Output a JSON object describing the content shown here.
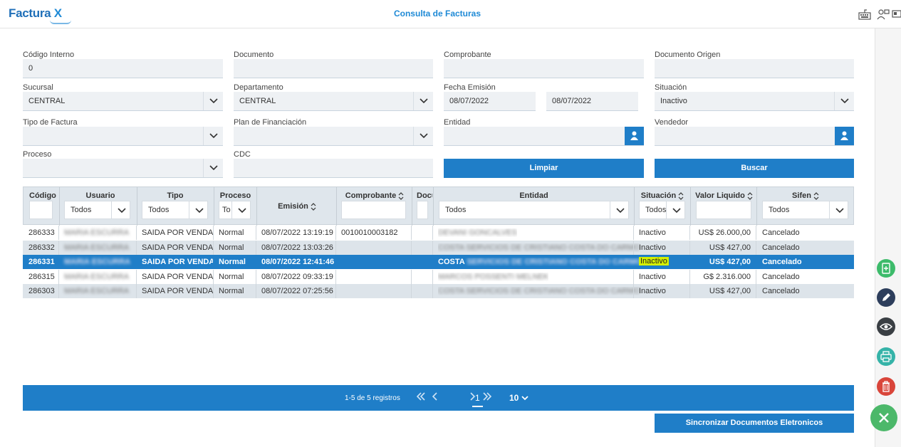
{
  "app": {
    "logo_main": "Factura",
    "logo_x": "X",
    "title": "Consulta de Facturas"
  },
  "form": {
    "codigo_interno": {
      "label": "Código Interno",
      "value": "0"
    },
    "documento": {
      "label": "Documento",
      "value": ""
    },
    "comprobante": {
      "label": "Comprobante",
      "value": ""
    },
    "documento_origen": {
      "label": "Documento Origen",
      "value": ""
    },
    "sucursal": {
      "label": "Sucursal",
      "value": "CENTRAL"
    },
    "departamento": {
      "label": "Departamento",
      "value": "CENTRAL"
    },
    "fecha_emision": {
      "label": "Fecha Emisión",
      "from": "08/07/2022",
      "to": "08/07/2022"
    },
    "situacion": {
      "label": "Situación",
      "value": "Inactivo"
    },
    "tipo_factura": {
      "label": "Tipo de Factura",
      "value": ""
    },
    "plan_financiacion": {
      "label": "Plan de Financiación",
      "value": ""
    },
    "entidad": {
      "label": "Entidad",
      "value": ""
    },
    "vendedor": {
      "label": "Vendedor",
      "value": ""
    },
    "proceso": {
      "label": "Proceso",
      "value": ""
    },
    "cdc": {
      "label": "CDC",
      "value": ""
    },
    "limpiar_label": "Limpiar",
    "buscar_label": "Buscar"
  },
  "grid": {
    "columns": {
      "codigo": "Código",
      "usuario": "Usuario",
      "tipo": "Tipo",
      "proceso": "Proceso",
      "emision": "Emisión",
      "comprobante": "Comprobante",
      "documento": "Docu",
      "entidad": "Entidad",
      "situacion": "Situación",
      "valor": "Valor Liquido",
      "sifen": "Sifen"
    },
    "filters": {
      "usuario": "Todos",
      "tipo": "Todos",
      "proceso": "To",
      "entidad": "Todos",
      "situacion": "Todos",
      "sifen": "Todos"
    },
    "rows": [
      {
        "codigo": "286333",
        "usuario": "MARIA ESCURRA",
        "tipo": "SAIDA POR VENDA C",
        "proceso": "Normal",
        "emision": "08/07/2022 13:19:19",
        "comprobante": "0010010003182",
        "entidad_prefix": "",
        "entidad": "DEVANI GONCALVES",
        "situacion": "Inactivo",
        "valor": "US$ 26.000,00",
        "sifen": "Cancelado"
      },
      {
        "codigo": "286332",
        "usuario": "MARIA ESCURRA",
        "tipo": "SAIDA POR VENDA",
        "proceso": "Normal",
        "emision": "08/07/2022 13:03:26",
        "comprobante": "",
        "entidad_prefix": "",
        "entidad": "COSTA SERVICIOS DE CRISTIANO COSTA DO CARMO",
        "situacion": "Inactivo",
        "valor": "US$ 427,00",
        "sifen": "Cancelado"
      },
      {
        "codigo": "286331",
        "usuario": "MARIA ESCURRA",
        "tipo": "SAIDA POR VENDA",
        "proceso": "Normal",
        "emision": "08/07/2022 12:41:46",
        "comprobante": "",
        "entidad_prefix": "COSTA",
        "entidad": "SERVICIOS DE CRISTIANO COSTA DO CARMO",
        "situacion": "Inactivo",
        "valor": "US$ 427,00",
        "sifen": "Cancelado"
      },
      {
        "codigo": "286315",
        "usuario": "MARIA ESCURRA",
        "tipo": "SAIDA POR VENDA C",
        "proceso": "Normal",
        "emision": "08/07/2022 09:33:19",
        "comprobante": "",
        "entidad_prefix": "",
        "entidad": "MARCOS POSSENTI MELNEK",
        "situacion": "Inactivo",
        "valor": "G$ 2.316.000",
        "sifen": "Cancelado"
      },
      {
        "codigo": "286303",
        "usuario": "MARIA ESCURRA",
        "tipo": "SAIDA POR VENDA",
        "proceso": "Normal",
        "emision": "08/07/2022 07:25:56",
        "comprobante": "",
        "entidad_prefix": "",
        "entidad": "COSTA SERVICIOS DE CRISTIANO COSTA DO CARMO",
        "situacion": "Inactivo",
        "valor": "US$ 427,00",
        "sifen": "Cancelado"
      }
    ]
  },
  "pager": {
    "info": "1-5 de 5 registros",
    "page": "1",
    "page_size": "10"
  },
  "sync_label": "Sincronizar Documentos Eletronicos",
  "colors": {
    "primary": "#1f7ec8",
    "add": "#3dbb6b",
    "edit": "#2d3e5c",
    "view": "#3a3f44",
    "print": "#35b3a8",
    "delete": "#d9453a",
    "close": "#4cb86a"
  }
}
